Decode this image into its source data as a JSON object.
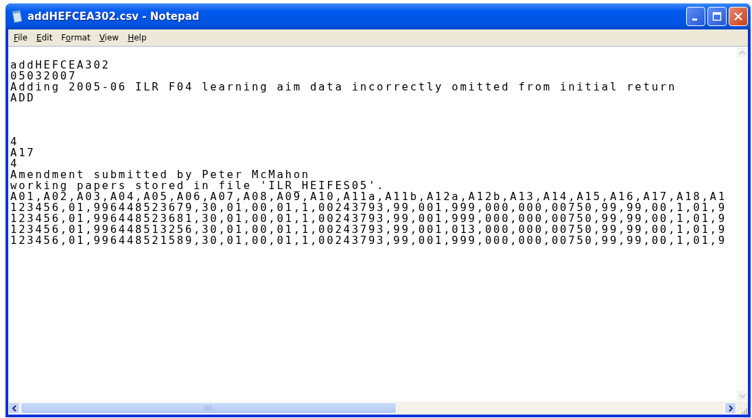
{
  "window": {
    "title": "addHEFCEA302.csv - Notepad"
  },
  "menu": [
    {
      "access_key": "F",
      "rest": "ile"
    },
    {
      "access_key": "E",
      "rest": "dit"
    },
    {
      "prefix": "F",
      "access_key": "o",
      "rest": "rmat"
    },
    {
      "access_key": "V",
      "rest": "iew"
    },
    {
      "access_key": "H",
      "rest": "elp"
    }
  ],
  "text_blocks": [
    {
      "lines": [
        "addHEFCEA302",
        "05032007",
        "Adding 2005-06 ILR F04 learning aim data incorrectly omitted from initial return",
        "ADD"
      ]
    },
    {
      "lines": [
        "4",
        "A17",
        "4",
        "Amendment submitted by Peter McMahon",
        "working papers stored in file 'ILR_HEIFES05'.",
        "A01,A02,A03,A04,A05,A06,A07,A08,A09,A10,A11a,A11b,A12a,A12b,A13,A14,A15,A16,A17,A18,A1",
        "123456,01,996448523679,30,01,00,01,1,00243793,99,001,999,000,000,00750,99,99,00,1,01,9",
        "123456,01,996448523681,30,01,00,01,1,00243793,99,001,999,000,000,00750,99,99,00,1,01,9",
        "123456,01,996448513256,30,01,00,01,1,00243793,99,001,013,000,000,00750,99,99,00,1,01,9",
        "123456,01,996448521589,30,01,00,01,1,00243793,99,001,999,000,000,00750,99,99,00,1,01,9"
      ]
    }
  ]
}
